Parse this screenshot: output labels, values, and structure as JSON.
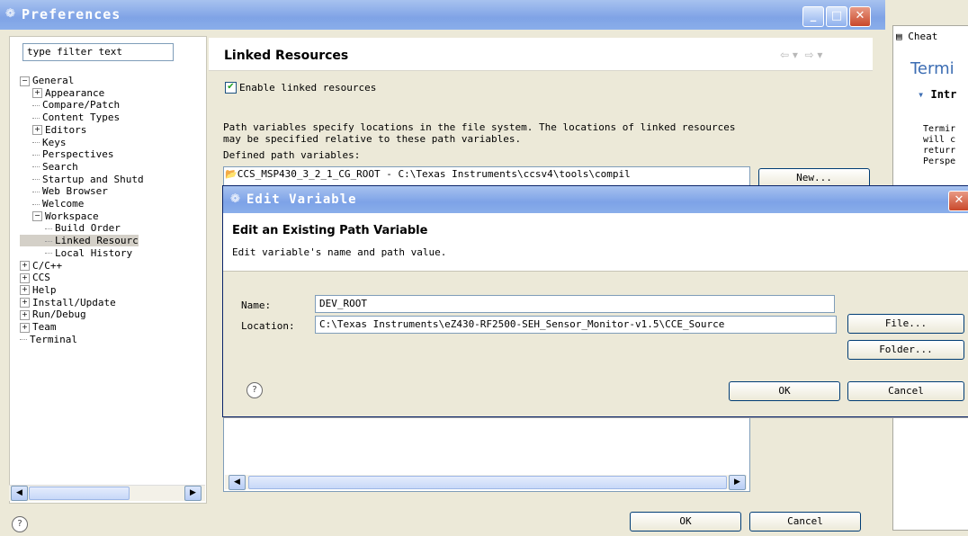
{
  "preferences": {
    "title": "Preferences",
    "filter_placeholder": "type filter text",
    "tree": [
      {
        "label": "General",
        "level": 0,
        "toggle": "−"
      },
      {
        "label": "Appearance",
        "level": 1,
        "toggle": "+"
      },
      {
        "label": "Compare/Patch",
        "level": 1,
        "toggle": ""
      },
      {
        "label": "Content Types",
        "level": 1,
        "toggle": ""
      },
      {
        "label": "Editors",
        "level": 1,
        "toggle": "+"
      },
      {
        "label": "Keys",
        "level": 1,
        "toggle": ""
      },
      {
        "label": "Perspectives",
        "level": 1,
        "toggle": ""
      },
      {
        "label": "Search",
        "level": 1,
        "toggle": ""
      },
      {
        "label": "Startup and Shutd",
        "level": 1,
        "toggle": ""
      },
      {
        "label": "Web Browser",
        "level": 1,
        "toggle": ""
      },
      {
        "label": "Welcome",
        "level": 1,
        "toggle": ""
      },
      {
        "label": "Workspace",
        "level": 1,
        "toggle": "−"
      },
      {
        "label": "Build Order",
        "level": 2,
        "toggle": ""
      },
      {
        "label": "Linked Resourc",
        "level": 2,
        "toggle": "",
        "selected": true
      },
      {
        "label": "Local History",
        "level": 2,
        "toggle": ""
      },
      {
        "label": "C/C++",
        "level": 0,
        "toggle": "+"
      },
      {
        "label": "CCS",
        "level": 0,
        "toggle": "+"
      },
      {
        "label": "Help",
        "level": 0,
        "toggle": "+"
      },
      {
        "label": "Install/Update",
        "level": 0,
        "toggle": "+"
      },
      {
        "label": "Run/Debug",
        "level": 0,
        "toggle": "+"
      },
      {
        "label": "Team",
        "level": 0,
        "toggle": "+"
      },
      {
        "label": "Terminal",
        "level": 0,
        "toggle": ""
      }
    ],
    "page_title": "Linked Resources",
    "enable_linked_label": "Enable linked resources",
    "enable_linked_checked": true,
    "description_line1": "Path variables specify locations in the file system. The locations of linked resources",
    "description_line2": "may be specified relative to these path variables.",
    "defined_label": "Defined path variables:",
    "variable_row": "CCS_MSP430_3_2_1_CG_ROOT - C:\\Texas Instruments\\ccsv4\\tools\\compil",
    "new_button": "New...",
    "ok_button": "OK",
    "cancel_button": "Cancel"
  },
  "dialog": {
    "title": "Edit Variable",
    "heading": "Edit an Existing Path Variable",
    "subheading": "Edit variable's name and path value.",
    "name_label": "Name:",
    "name_value": "DEV_ROOT",
    "location_label": "Location:",
    "location_value": "C:\\Texas Instruments\\eZ430-RF2500-SEH_Sensor_Monitor-v1.5\\CCE_Source",
    "file_button": "File...",
    "folder_button": "Folder...",
    "ok_button": "OK",
    "cancel_button": "Cancel"
  },
  "cheat_sheet": {
    "tab_label": "Cheat",
    "title": "Termi",
    "section": "Intr",
    "lines": [
      "Termir",
      "will c",
      "returr",
      "Perspe"
    ]
  },
  "colors": {
    "titlebar": "#7fa3e6",
    "close_button": "#c9482b",
    "window_bg": "#ece9d8"
  }
}
